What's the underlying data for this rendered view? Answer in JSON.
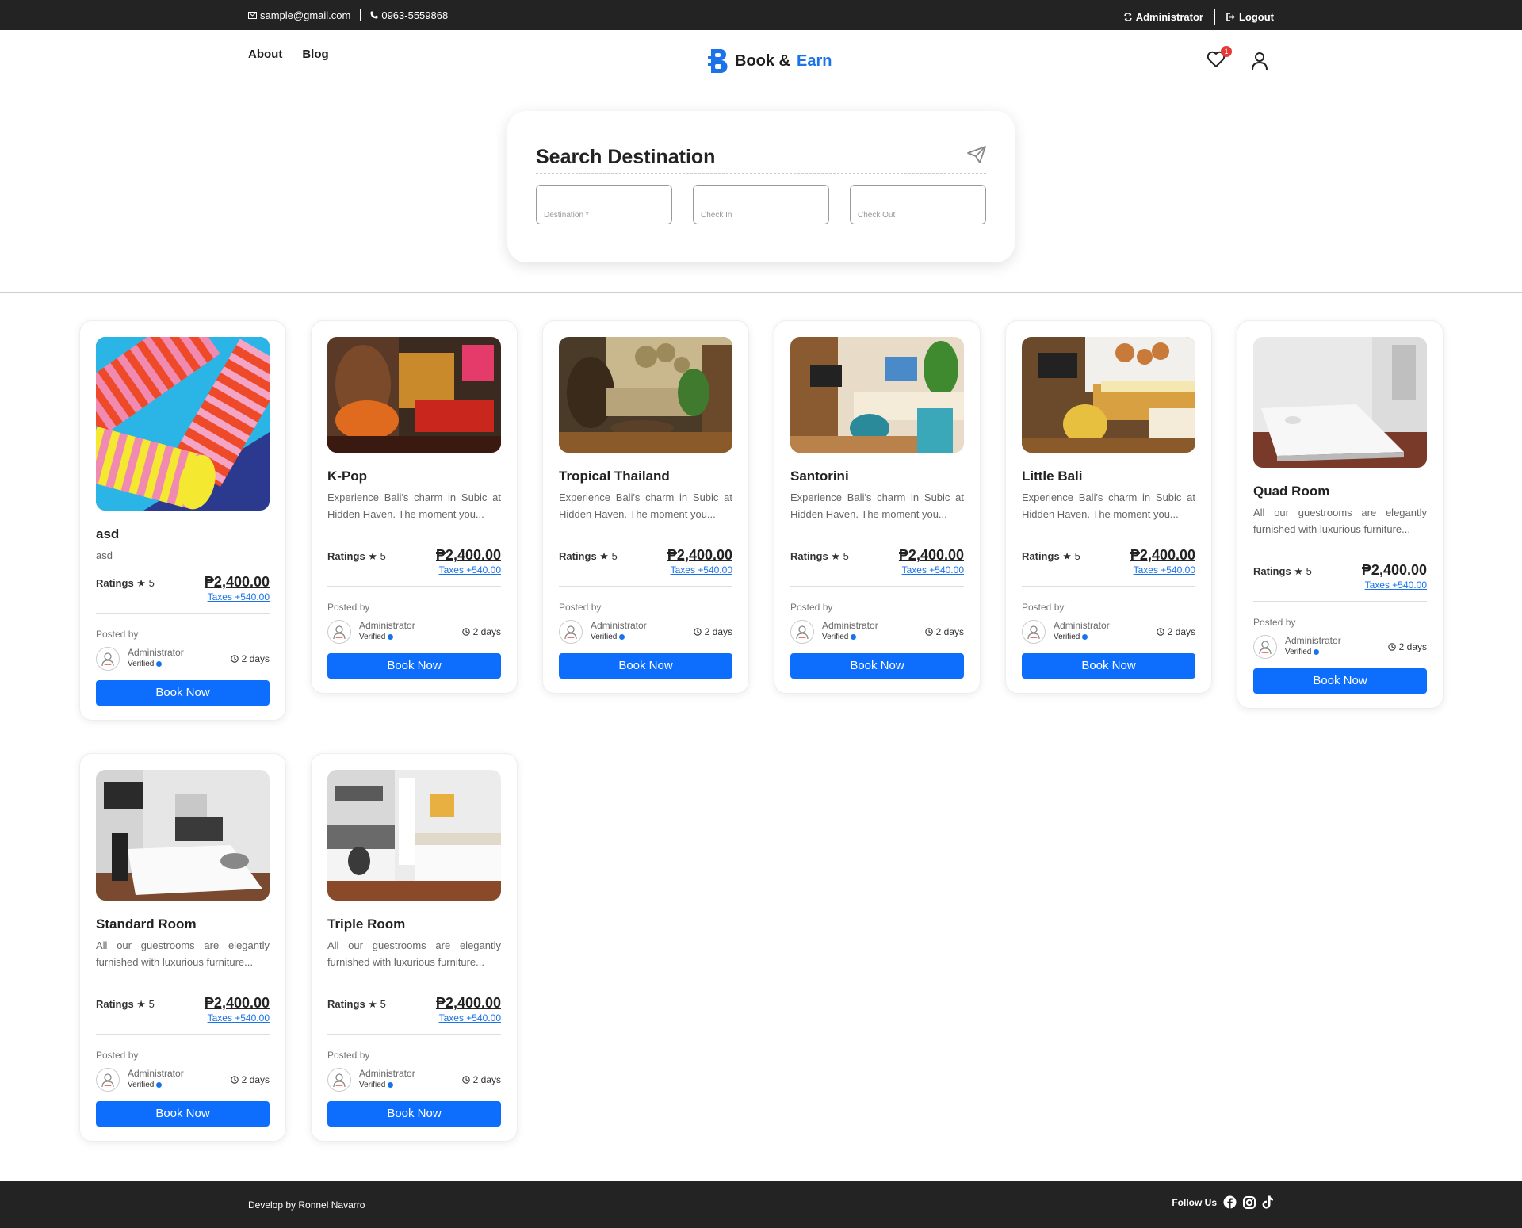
{
  "topbar": {
    "email": "sample@gmail.com",
    "phone": "0963-5559868",
    "account": "Administrator",
    "logout": "Logout"
  },
  "nav": {
    "about": "About",
    "blog": "Blog"
  },
  "logo": {
    "part1": "Book &",
    "part2": "Earn"
  },
  "wishlist_count": "1",
  "search": {
    "title": "Search Destination",
    "destination_label": "Destination *",
    "checkin_label": "Check In",
    "checkout_label": "Check Out"
  },
  "cards": [
    {
      "title": "asd",
      "desc": "asd",
      "ratings_label": "Ratings",
      "rating": "5",
      "price": "₱2,400.00",
      "taxes": "Taxes +540.00",
      "posted_by": "Posted by",
      "author": "Administrator",
      "verified": "Verified",
      "time": "2 days",
      "button": "Book Now"
    },
    {
      "title": "K-Pop",
      "desc": "Experience Bali's charm in Subic at Hidden Haven. The moment you...",
      "ratings_label": "Ratings",
      "rating": "5",
      "price": "₱2,400.00",
      "taxes": "Taxes +540.00",
      "posted_by": "Posted by",
      "author": "Administrator",
      "verified": "Verified",
      "time": "2 days",
      "button": "Book Now"
    },
    {
      "title": "Tropical Thailand",
      "desc": "Experience Bali's charm in Subic at Hidden Haven. The moment you...",
      "ratings_label": "Ratings",
      "rating": "5",
      "price": "₱2,400.00",
      "taxes": "Taxes +540.00",
      "posted_by": "Posted by",
      "author": "Administrator",
      "verified": "Verified",
      "time": "2 days",
      "button": "Book Now"
    },
    {
      "title": "Santorini",
      "desc": "Experience Bali's charm in Subic at Hidden Haven. The moment you...",
      "ratings_label": "Ratings",
      "rating": "5",
      "price": "₱2,400.00",
      "taxes": "Taxes +540.00",
      "posted_by": "Posted by",
      "author": "Administrator",
      "verified": "Verified",
      "time": "2 days",
      "button": "Book Now"
    },
    {
      "title": "Little Bali",
      "desc": "Experience Bali's charm in Subic at Hidden Haven. The moment you...",
      "ratings_label": "Ratings",
      "rating": "5",
      "price": "₱2,400.00",
      "taxes": "Taxes +540.00",
      "posted_by": "Posted by",
      "author": "Administrator",
      "verified": "Verified",
      "time": "2 days",
      "button": "Book Now"
    },
    {
      "title": "Quad Room",
      "desc": "All our guestrooms are elegantly furnished with luxurious furniture...",
      "ratings_label": "Ratings",
      "rating": "5",
      "price": "₱2,400.00",
      "taxes": "Taxes +540.00",
      "posted_by": "Posted by",
      "author": "Administrator",
      "verified": "Verified",
      "time": "2 days",
      "button": "Book Now"
    },
    {
      "title": "Standard Room",
      "desc": "All our guestrooms are elegantly furnished with luxurious furniture...",
      "ratings_label": "Ratings",
      "rating": "5",
      "price": "₱2,400.00",
      "taxes": "Taxes +540.00",
      "posted_by": "Posted by",
      "author": "Administrator",
      "verified": "Verified",
      "time": "2 days",
      "button": "Book Now"
    },
    {
      "title": "Triple Room",
      "desc": "All our guestrooms are elegantly furnished with luxurious furniture...",
      "ratings_label": "Ratings",
      "rating": "5",
      "price": "₱2,400.00",
      "taxes": "Taxes +540.00",
      "posted_by": "Posted by",
      "author": "Administrator",
      "verified": "Verified",
      "time": "2 days",
      "button": "Book Now"
    }
  ],
  "footer": {
    "credit": "Develop by Ronnel Navarro",
    "follow": "Follow Us"
  },
  "colors": {
    "accent": "#1a73e8",
    "button": "#0d6efd",
    "dark": "#232323",
    "badge": "#e53935"
  },
  "icons": [
    "mail-icon",
    "phone-icon",
    "switch-icon",
    "logout-icon",
    "heart-icon",
    "user-icon",
    "send-icon",
    "star-icon",
    "clock-icon",
    "facebook-icon",
    "instagram-icon",
    "tiktok-icon"
  ]
}
